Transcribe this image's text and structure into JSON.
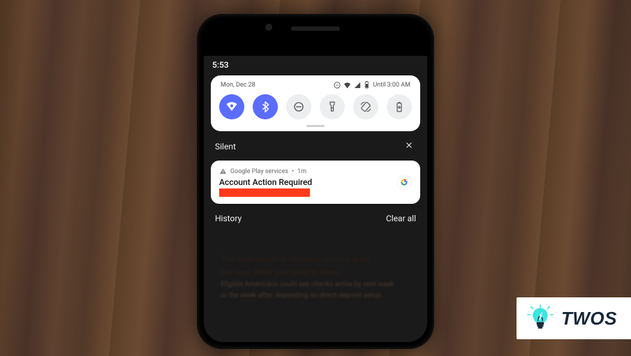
{
  "status_bar": {
    "time": "5:53"
  },
  "quick_settings": {
    "date": "Mon, Dec 28",
    "dnd_until": "Until 3:00 AM",
    "tiles": [
      {
        "name": "wifi",
        "active": true
      },
      {
        "name": "bluetooth",
        "active": true
      },
      {
        "name": "do-not-disturb",
        "active": false
      },
      {
        "name": "flashlight",
        "active": false
      },
      {
        "name": "auto-rotate",
        "active": false
      },
      {
        "name": "battery-saver",
        "active": false
      }
    ]
  },
  "silent": {
    "label": "Silent"
  },
  "notification": {
    "app": "Google Play services",
    "age": "1m",
    "separator": "•",
    "title": "Account Action Required"
  },
  "history": {
    "label": "History",
    "clear_all": "Clear all"
  },
  "blurred": {
    "l1": "The next round of stimulus checks is on",
    "l2": "the way. What you need to know.",
    "l3": "Eligible Americans could see checks arrive by next week",
    "l4": "or the week after, depending on direct deposit setup."
  },
  "watermark": {
    "text": "TWOS"
  }
}
